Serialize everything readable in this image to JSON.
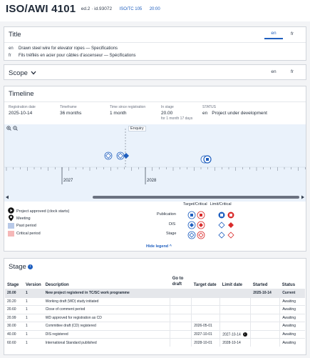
{
  "header": {
    "code": "ISO/AWI 4101",
    "edition": "ed.2 · id.93072",
    "committee": "ISO/TC 105",
    "sc": "20:00"
  },
  "title_panel": {
    "label": "Title",
    "tabs": [
      "en",
      "fr"
    ],
    "rows": [
      {
        "lang": "en",
        "text": "Drawn steel wire for elevator ropes — Specifications"
      },
      {
        "lang": "fr",
        "text": "Fils tréfilés en acier pour câbles d'ascenseur — Spécifications"
      }
    ]
  },
  "scope_panel": {
    "label": "Scope",
    "tabs": [
      "en",
      "fr"
    ]
  },
  "timeline": {
    "label": "Timeline",
    "stats": {
      "reg_label": "Registration date",
      "reg_value": "2025-10-14",
      "tf_label": "Timeframe",
      "tf_value": "36 months",
      "tsr_label": "Time since registration",
      "tsr_value": "1 month",
      "stage_label": "In stage",
      "stage_value": "20.00",
      "stage_sub": "for 1 month 17 days",
      "status_label": "STATUS",
      "status_lang": "en",
      "status_value": "Project under development"
    },
    "zoom": "⊕ ⊖",
    "enquiry_label": "Enquiry",
    "year_labels": [
      "2027",
      "2028"
    ],
    "legend": {
      "approved": "Project approved (clock starts)",
      "meeting": "Meeting",
      "past": "Past period",
      "critical": "Critical period",
      "col_target": "Target",
      "col_critical": "Critical",
      "col_limit": "Limit",
      "col_critical2": "Critical",
      "row_publication": "Publication",
      "row_dis": "DIS",
      "row_stage": "Stage",
      "hide": "Hide legend ^"
    }
  },
  "stage_panel": {
    "label": "Stage",
    "columns": [
      "Stage",
      "Version",
      "Description",
      "Go to draft",
      "Target date",
      "Limit date",
      "Started",
      "Status"
    ],
    "rows": [
      {
        "stage": "20.00",
        "version": "1",
        "desc": "New project registered in TC/SC work programme",
        "target": "",
        "limit": "",
        "started": "2025-10-14",
        "status": "Current"
      },
      {
        "stage": "20.20",
        "version": "1",
        "desc": "Working draft (WD) study initiated",
        "target": "",
        "limit": "",
        "started": "",
        "status": "Awaiting"
      },
      {
        "stage": "20.60",
        "version": "1",
        "desc": "Close of comment period",
        "target": "",
        "limit": "",
        "started": "",
        "status": "Awaiting"
      },
      {
        "stage": "20.99",
        "version": "1",
        "desc": "WD approved for registration as CD",
        "target": "",
        "limit": "",
        "started": "",
        "status": "Awaiting"
      },
      {
        "stage": "30.00",
        "version": "1",
        "desc": "Committee draft (CD) registered",
        "target": "2026-05-01",
        "limit": "",
        "started": "",
        "status": "Awaiting"
      },
      {
        "stage": "40.00",
        "version": "1",
        "desc": "DIS registered",
        "target": "2027-10-01",
        "limit": "2027-10-14",
        "started": "",
        "status": "Awaiting"
      },
      {
        "stage": "60.60",
        "version": "1",
        "desc": "International Standard published",
        "target": "2028-10-01",
        "limit": "2028-10-14",
        "started": "",
        "status": "Awaiting"
      }
    ]
  },
  "colors": {
    "accent": "#1f5fbf",
    "critical": "#d92b2b",
    "past": "#b8c9e8",
    "critical_period": "#f5b8b8"
  }
}
